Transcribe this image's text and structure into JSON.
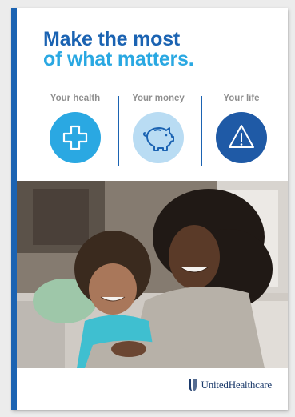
{
  "cover": {
    "headline_line1": "Make the most",
    "headline_line2": "of what matters.",
    "colors": {
      "brand_blue": "#1b63b2",
      "light_blue": "#2aa8e2",
      "pale_blue": "#b9dcf3",
      "navy": "#1f5aa6",
      "label_gray": "#8f8f8f"
    }
  },
  "pillars": [
    {
      "label": "Your health",
      "icon": "plus-icon"
    },
    {
      "label": "Your money",
      "icon": "piggy-bank-icon"
    },
    {
      "label": "Your life",
      "icon": "warning-triangle-icon"
    }
  ],
  "photo": {
    "subject": "photo"
  },
  "brand": {
    "name": "UnitedHealthcare",
    "icon": "unitedhealthcare-logo-icon"
  }
}
